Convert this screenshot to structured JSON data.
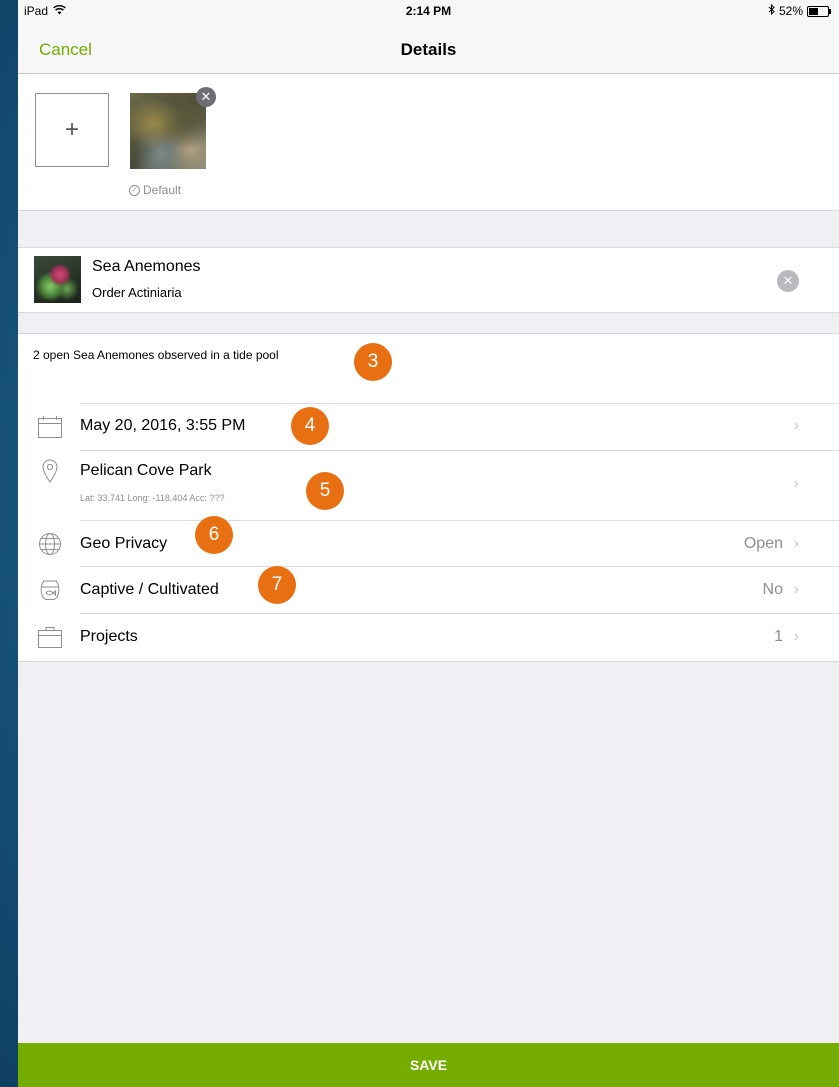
{
  "status_bar": {
    "device": "iPad",
    "time": "2:14 PM",
    "battery_text": "52%",
    "battery_level": 0.52
  },
  "nav": {
    "cancel_label": "Cancel",
    "title": "Details"
  },
  "photos": {
    "add_label": "+",
    "default_label": "Default"
  },
  "taxon": {
    "common_name": "Sea Anemones",
    "rank_name": "Order Actiniaria"
  },
  "description": "2 open Sea Anemones observed in a tide pool",
  "rows": {
    "date": {
      "label": "May 20, 2016, 3:55 PM"
    },
    "location": {
      "label": "Pelican Cove Park",
      "coords": "Lat: 33.741  Long: -118.404  Acc: ???"
    },
    "geo_privacy": {
      "label": "Geo Privacy",
      "value": "Open"
    },
    "captive": {
      "label": "Captive / Cultivated",
      "value": "No"
    },
    "projects": {
      "label": "Projects",
      "value": "1"
    }
  },
  "callouts": [
    "3",
    "4",
    "5",
    "6",
    "7"
  ],
  "save_label": "SAVE",
  "colors": {
    "accent": "#74ac00",
    "callout": "#e86f12",
    "secondary_text": "#8e8e93"
  }
}
